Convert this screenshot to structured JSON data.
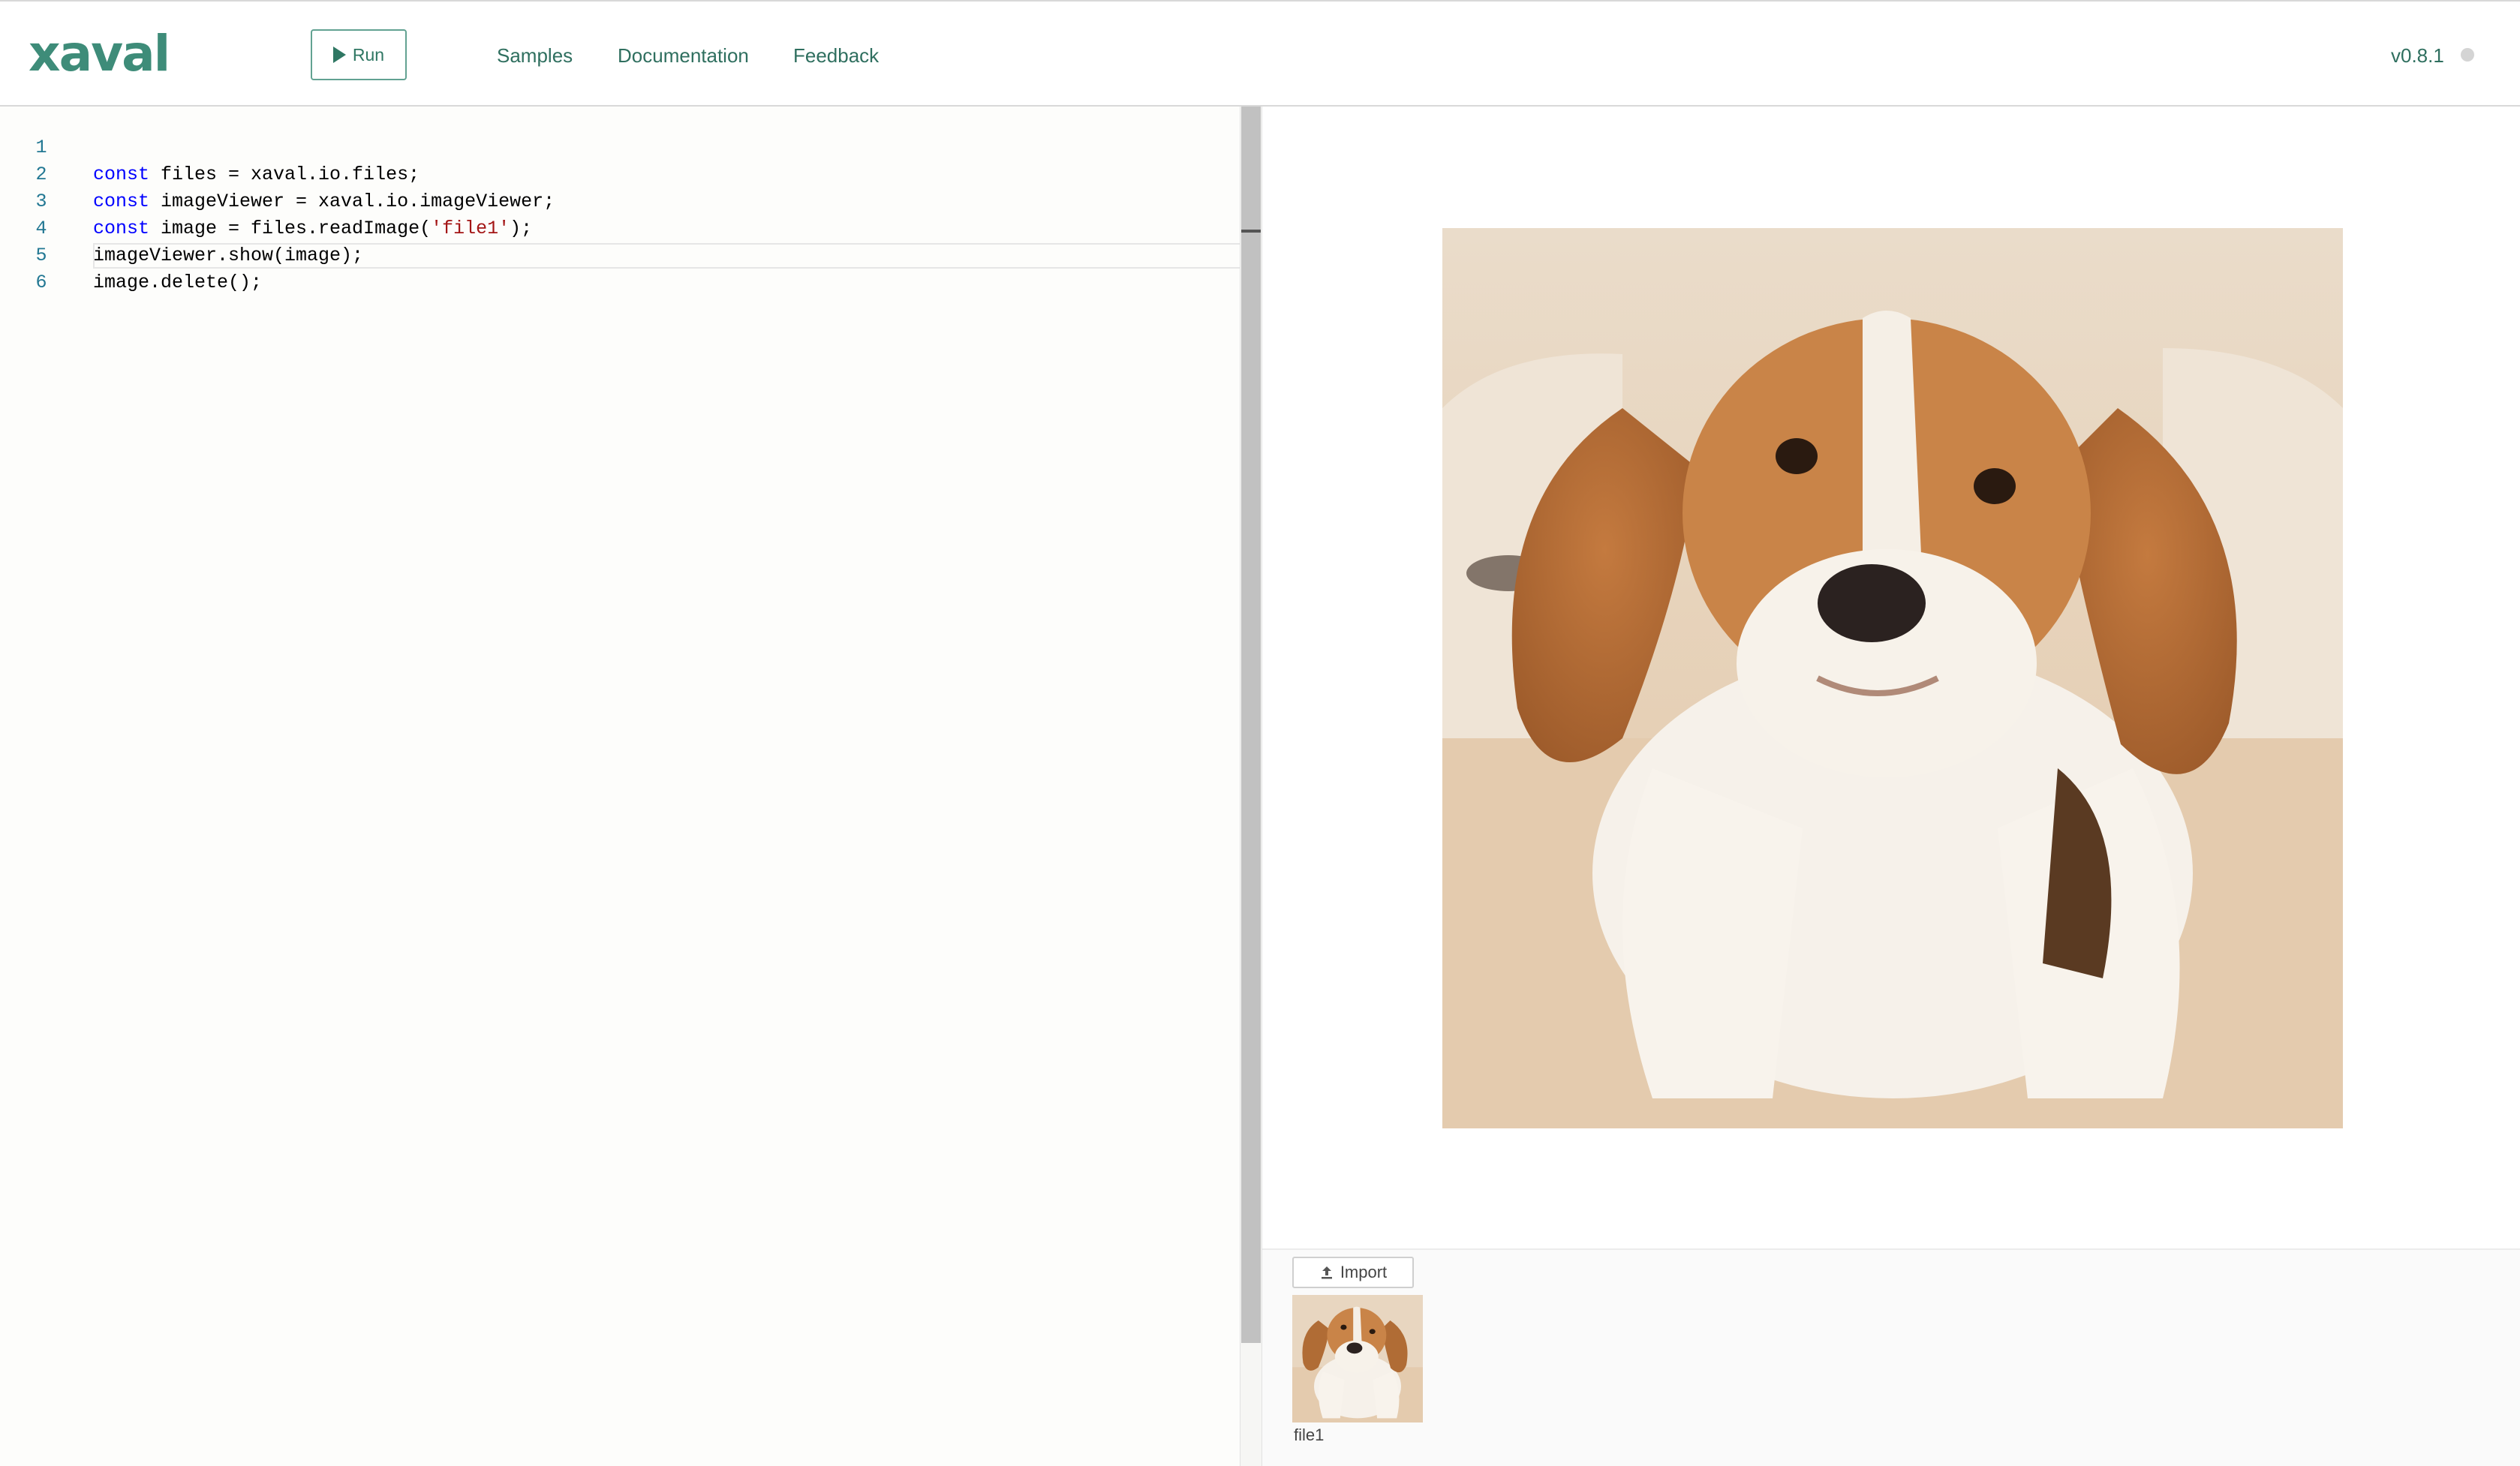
{
  "header": {
    "logo": "xaval",
    "run_label": "Run",
    "nav": [
      "Samples",
      "Documentation",
      "Feedback"
    ],
    "version": "v0.8.1"
  },
  "editor": {
    "lines": [
      {
        "number": "1",
        "kw": "const",
        "text": " files = xaval.io.files;"
      },
      {
        "number": "2",
        "kw": "const",
        "text": " imageViewer = xaval.io.imageViewer;"
      },
      {
        "number": "3",
        "kw": "const",
        "text": " image = files.readImage(",
        "str": "'file1'",
        "tail": ");"
      },
      {
        "number": "4",
        "text": "imageViewer.show(image);"
      },
      {
        "number": "5",
        "text": "image.delete();"
      },
      {
        "number": "6",
        "text": ""
      }
    ]
  },
  "files": {
    "import_label": "Import",
    "items": [
      {
        "name": "file1"
      }
    ]
  },
  "colors": {
    "accent": "#3e8c79",
    "keyword": "#0000ff",
    "string": "#a31515",
    "line_number": "#237893"
  },
  "icons": {
    "run": "play-icon",
    "import": "upload-icon",
    "status": "status-dot-icon"
  }
}
